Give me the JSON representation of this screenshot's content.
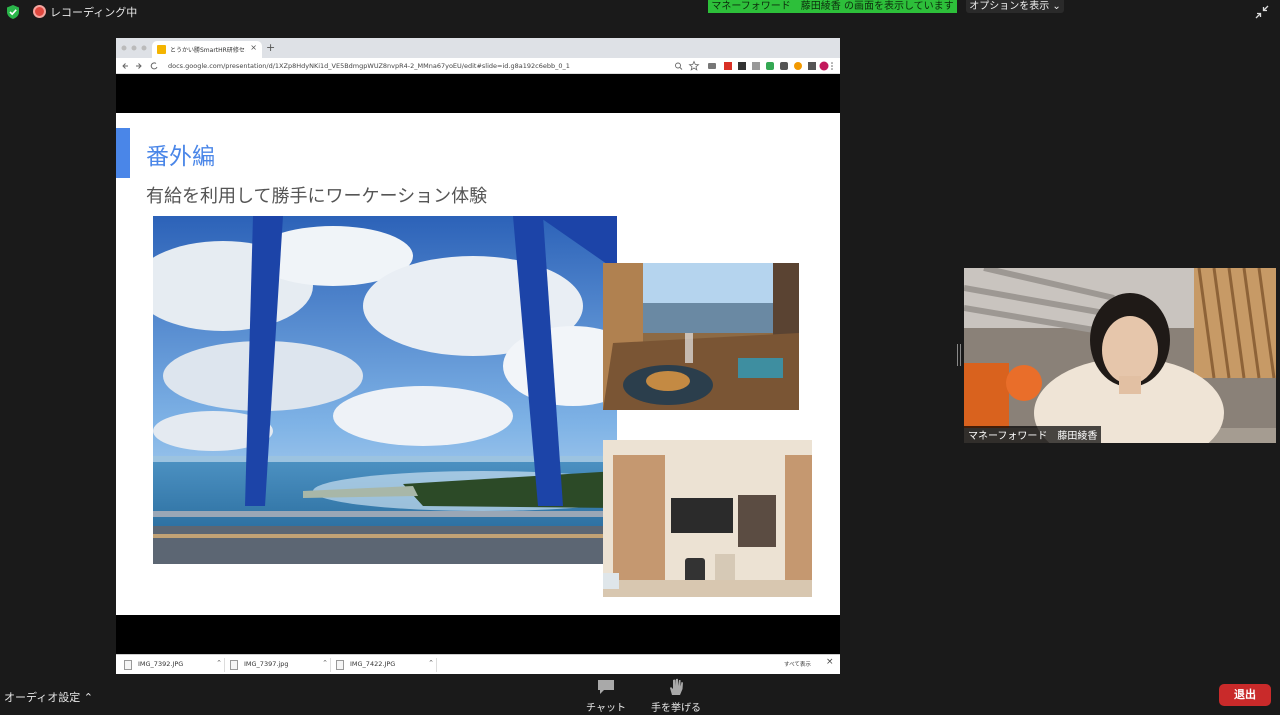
{
  "topbar": {
    "recording_label": "レコーディング中",
    "share_banner": "マネーフォワード　藤田綾香 の画面を表示しています",
    "options_label": "オプションを表示 ⌄",
    "rec_color": "#e0483f",
    "banner_color": "#2dbf3a"
  },
  "browser": {
    "tab_title": "とうかい勝SmartHR研修セミナー",
    "url": "docs.google.com/presentation/d/1XZp8HdyNKi1d_VE5BdmgpWUZ8nvpR4-2_MMna67yoEU/edit#slide=id.g8a192c6ebb_0_1",
    "downloads": [
      {
        "name": "IMG_7392.JPG"
      },
      {
        "name": "IMG_7397.jpg"
      },
      {
        "name": "IMG_7422.JPG"
      }
    ],
    "show_all": "すべて表示"
  },
  "slide": {
    "title": "番外編",
    "subtitle": "有給を利用して勝手にワーケーション体験",
    "accent_color": "#4a86e8"
  },
  "participant": {
    "name": "マネーフォワード　藤田綾香"
  },
  "controls": {
    "audio_settings": "オーディオ設定  ⌃",
    "chat": "チャット",
    "raise_hand": "手を挙げる",
    "leave": "退出",
    "leave_color": "#c92a2a"
  }
}
